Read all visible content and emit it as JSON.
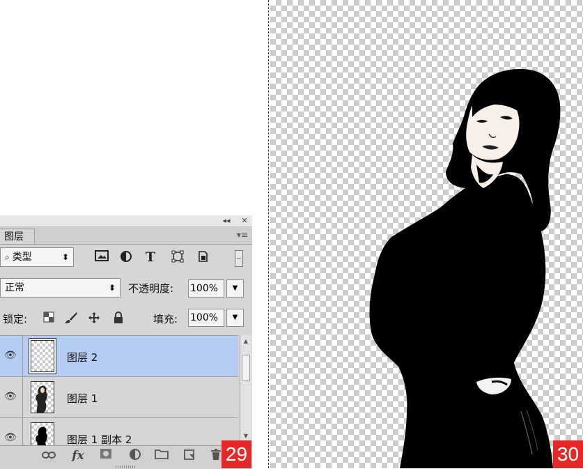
{
  "panel": {
    "collapse_glyph": "◂◂",
    "close_glyph": "✕",
    "tab_label": "图层",
    "menu_glyph": "▾≡",
    "filter": {
      "search_glyph": "⌕",
      "label": "类型",
      "caret": "⬍"
    },
    "filter_icons": [
      "image-filter-icon",
      "adjustment-filter-icon",
      "type-filter-icon",
      "shape-filter-icon",
      "smart-object-filter-icon"
    ],
    "blend_mode": {
      "value": "正常",
      "caret": "⬍"
    },
    "opacity": {
      "label": "不透明度:",
      "value": "100%"
    },
    "lock": {
      "label": "锁定:"
    },
    "fill": {
      "label": "填充:",
      "value": "100%"
    },
    "layers": [
      {
        "name": "图层 2",
        "selected": true,
        "visible": true
      },
      {
        "name": "图层 1",
        "selected": false,
        "visible": true
      },
      {
        "name": "图层 1 副本 2",
        "selected": false,
        "visible": true
      }
    ],
    "bottom_icons": [
      "link-layers-icon",
      "fx-icon",
      "add-mask-icon",
      "adjustment-layer-icon",
      "new-group-icon",
      "new-layer-icon",
      "delete-layer-icon"
    ],
    "fx_label": "fx"
  },
  "badges": {
    "left": "29",
    "right": "30"
  },
  "colors": {
    "badge": "#e12a29",
    "selection": "#b5cdf2",
    "panel": "#d6d6d6"
  }
}
